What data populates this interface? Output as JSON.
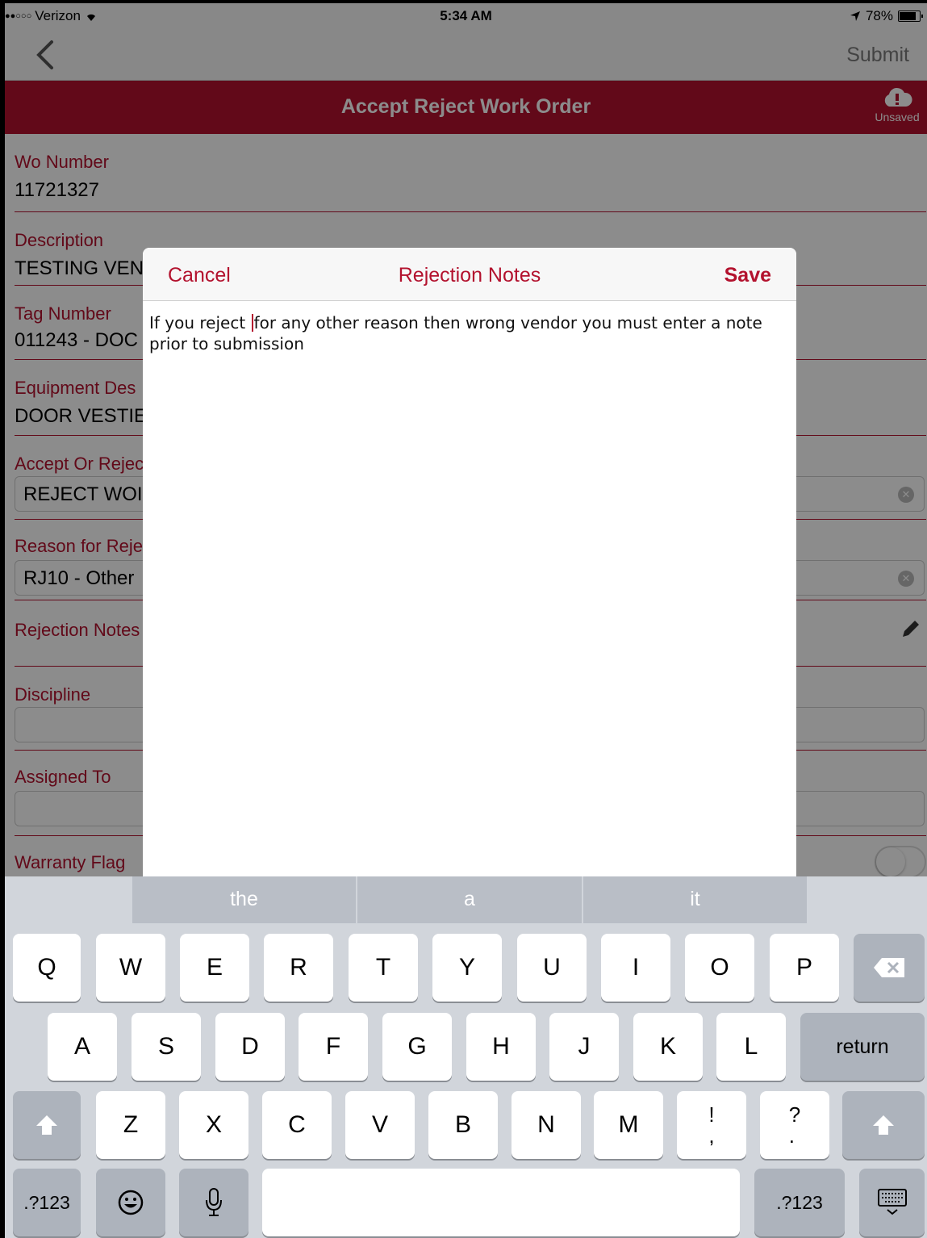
{
  "status": {
    "carrier": "Verizon",
    "time": "5:34 AM",
    "battery": "78%"
  },
  "nav": {
    "submit_label": "Submit"
  },
  "header": {
    "title": "Accept Reject Work Order",
    "unsaved_label": "Unsaved"
  },
  "form": {
    "wo_number_label": "Wo Number",
    "wo_number_value": "11721327",
    "description_label": "Description",
    "description_value": "TESTING VEN",
    "tag_label": "Tag Number",
    "tag_value": "011243 - DOC",
    "equip_label": "Equipment Des",
    "equip_value": "DOOR VESTIE",
    "accept_label": "Accept Or Rejec",
    "accept_value": "REJECT WOI",
    "reason_label": "Reason for Reje",
    "reason_value": "RJ10 - Other",
    "notes_label": "Rejection Notes",
    "discipline_label": "Discipline",
    "assigned_label": "Assigned To",
    "warranty_label": "Warranty Flag"
  },
  "modal": {
    "cancel_label": "Cancel",
    "title": "Rejection Notes",
    "save_label": "Save",
    "text_before": "If you reject ",
    "text_after": "for any other reason then wrong vendor you must enter a note prior to submission"
  },
  "keyboard": {
    "suggestions": [
      "the",
      "a",
      "it"
    ],
    "row1": [
      "Q",
      "W",
      "E",
      "R",
      "T",
      "Y",
      "U",
      "I",
      "O",
      "P"
    ],
    "row2": [
      "A",
      "S",
      "D",
      "F",
      "G",
      "H",
      "J",
      "K",
      "L"
    ],
    "row3": [
      "Z",
      "X",
      "C",
      "V",
      "B",
      "N",
      "M",
      "!\n,",
      "?\n."
    ],
    "return_label": "return",
    "numbers_label": ".?123"
  },
  "colors": {
    "accent": "#b3122e"
  }
}
